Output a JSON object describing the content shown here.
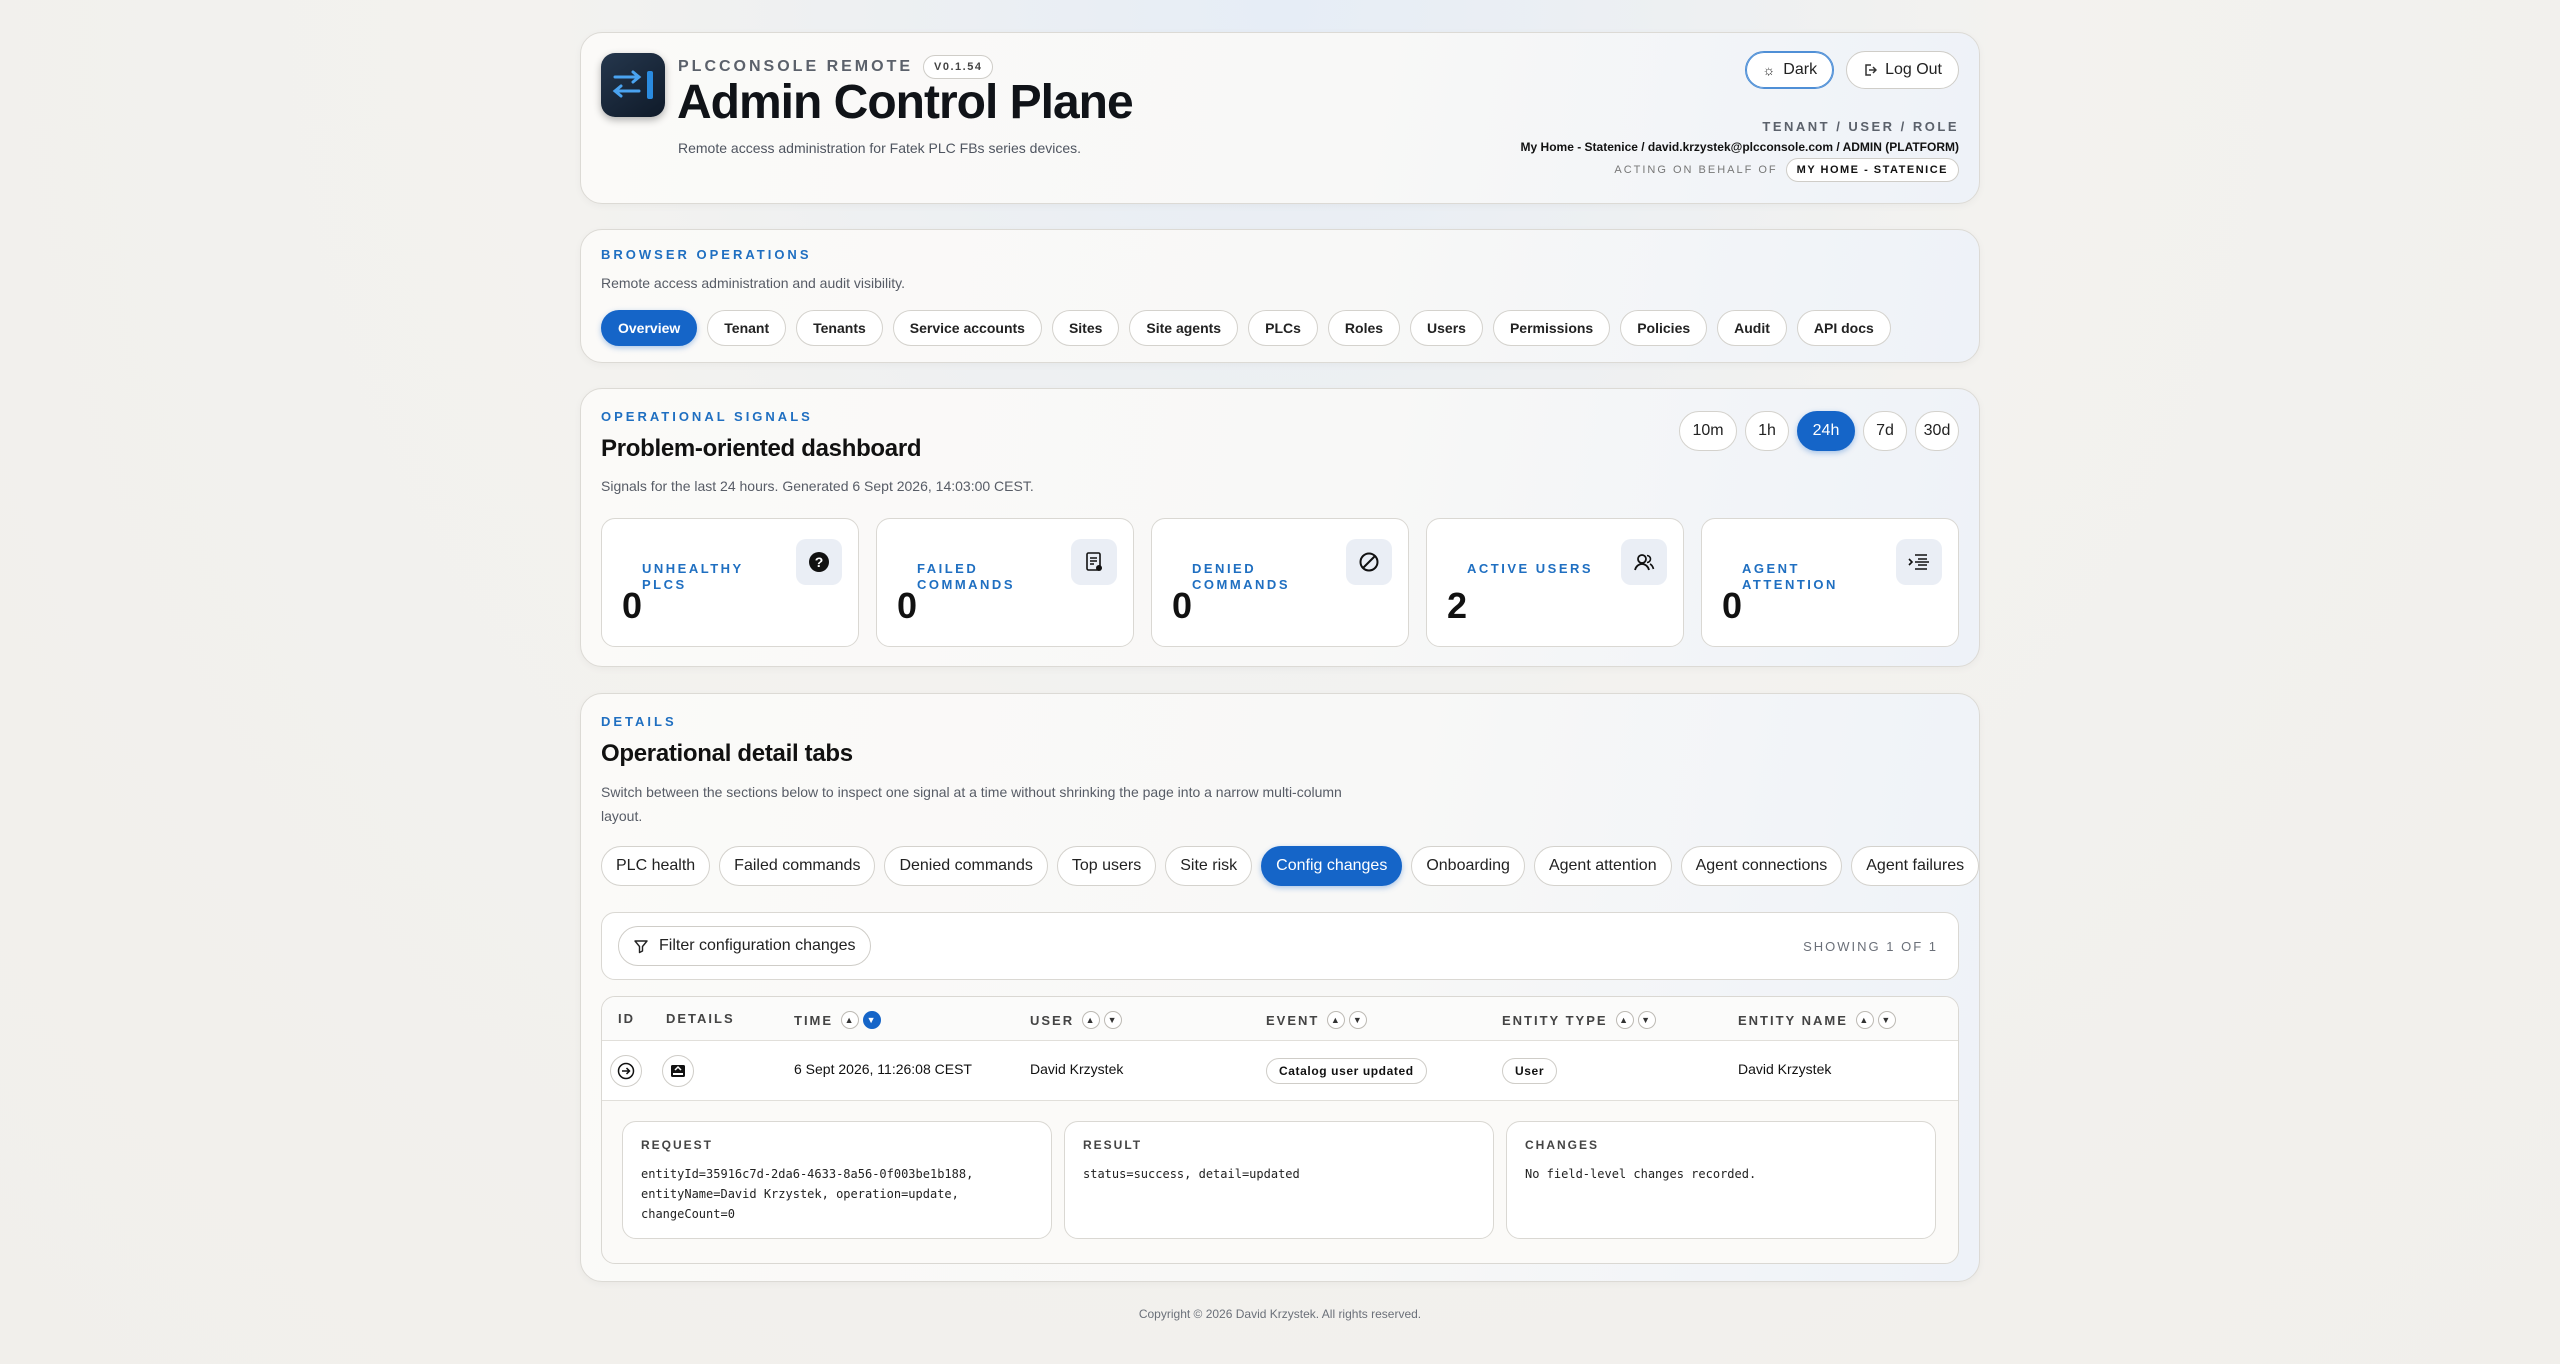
{
  "header": {
    "brand": "PLCCONSOLE REMOTE",
    "version": "V0.1.54",
    "title": "Admin Control Plane",
    "subtitle": "Remote access administration for Fatek PLC FBs series devices.",
    "dark_label": "Dark",
    "logout_label": "Log Out",
    "meta_label": "TENANT / USER / ROLE",
    "meta_value": "My Home - Statenice / david.krzystek@plcconsole.com / ADMIN (PLATFORM)",
    "behalf_label": "ACTING ON BEHALF OF",
    "behalf_value": "MY HOME - STATENICE"
  },
  "ops": {
    "kicker": "BROWSER OPERATIONS",
    "desc": "Remote access administration and audit visibility.",
    "tabs": [
      "Overview",
      "Tenant",
      "Tenants",
      "Service accounts",
      "Sites",
      "Site agents",
      "PLCs",
      "Roles",
      "Users",
      "Permissions",
      "Policies",
      "Audit",
      "API docs"
    ],
    "active": "Overview"
  },
  "signals": {
    "kicker": "OPERATIONAL SIGNALS",
    "title": "Problem-oriented dashboard",
    "desc": "Signals for the last 24 hours. Generated 6 Sept 2026, 14:03:00 CEST.",
    "ranges": [
      "10m",
      "1h",
      "24h",
      "7d",
      "30d"
    ],
    "active_range": "24h",
    "stats": [
      {
        "label": "UNHEALTHY PLCS",
        "value": "0",
        "icon": "question-icon"
      },
      {
        "label": "FAILED COMMANDS",
        "value": "0",
        "icon": "document-icon"
      },
      {
        "label": "DENIED COMMANDS",
        "value": "0",
        "icon": "block-icon"
      },
      {
        "label": "ACTIVE USERS",
        "value": "2",
        "icon": "users-icon"
      },
      {
        "label": "AGENT ATTENTION",
        "value": "0",
        "icon": "list-icon"
      }
    ]
  },
  "details": {
    "kicker": "DETAILS",
    "title": "Operational detail tabs",
    "desc": "Switch between the sections below to inspect one signal at a time without shrinking the page into a narrow multi-column layout.",
    "tabs": [
      "PLC health",
      "Failed commands",
      "Denied commands",
      "Top users",
      "Site risk",
      "Config changes",
      "Onboarding",
      "Agent attention",
      "Agent connections",
      "Agent failures"
    ],
    "active_tab": "Config changes",
    "filter_label": "Filter configuration changes",
    "showing": "SHOWING 1 OF 1",
    "columns": [
      "ID",
      "DETAILS",
      "TIME",
      "USER",
      "EVENT",
      "ENTITY TYPE",
      "ENTITY NAME"
    ],
    "row": {
      "time": "6 Sept 2026, 11:26:08 CEST",
      "user": "David Krzystek",
      "event": "Catalog user updated",
      "entity_type": "User",
      "entity_name": "David Krzystek"
    },
    "request_label": "REQUEST",
    "request_value": "entityId=35916c7d-2da6-4633-8a56-0f003be1b188, entityName=David Krzystek, operation=update, changeCount=0",
    "result_label": "RESULT",
    "result_value": "status=success, detail=updated",
    "changes_label": "CHANGES",
    "changes_value": "No field-level changes recorded."
  },
  "footer": "Copyright © 2026 David Krzystek. All rights reserved.",
  "colors": {
    "accent": "#1565c8",
    "kicker": "#1f6fc1"
  }
}
